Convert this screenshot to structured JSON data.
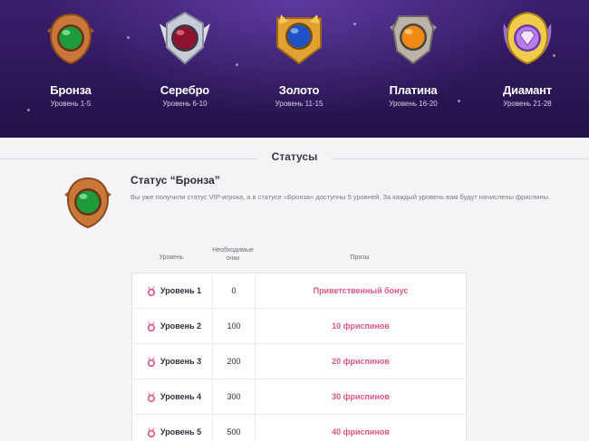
{
  "ranks": [
    {
      "name": "Бронза",
      "levels": "Уровень 1-5",
      "gem": "#1f9a3a",
      "frame": "#c9783a",
      "icon": "bronze-rank-badge-icon"
    },
    {
      "name": "Серебро",
      "levels": "Уровень 6-10",
      "gem": "#8c1230",
      "frame": "#c8ccd6",
      "icon": "silver-rank-badge-icon"
    },
    {
      "name": "Золото",
      "levels": "Уровень 11-15",
      "gem": "#1f52c4",
      "frame": "#e0a233",
      "icon": "gold-rank-badge-icon"
    },
    {
      "name": "Платина",
      "levels": "Уровень 16-20",
      "gem": "#f08a12",
      "frame": "#b9b3a8",
      "icon": "platinum-rank-badge-icon"
    },
    {
      "name": "Диамант",
      "levels": "Уровень 21-28",
      "gem": "#b77ee6",
      "frame": "#f0cc4a",
      "icon": "diamond-rank-badge-icon"
    }
  ],
  "section": {
    "title": "Статусы"
  },
  "status": {
    "heading": "Статус “Бронза”",
    "description": "Вы уже получили статус VIP-игрока, а в статусе «Бронза» доступны 5 уровней. За каждый уровень вам будут начислены фриспины.",
    "badge_icon": "bronze-status-badge-icon"
  },
  "table": {
    "headers": {
      "level": "Уровень",
      "points_line1": "Необходимые",
      "points_line2": "очки",
      "prizes": "Призы"
    },
    "rows": [
      {
        "level": "Уровень 1",
        "points": "0",
        "prize": "Приветственный бонус"
      },
      {
        "level": "Уровень 2",
        "points": "100",
        "prize": "10 фриспинов"
      },
      {
        "level": "Уровень 3",
        "points": "200",
        "prize": "20 фриспинов"
      },
      {
        "level": "Уровень 4",
        "points": "300",
        "prize": "30 фриспинов"
      },
      {
        "level": "Уровень 5",
        "points": "500",
        "prize": "40 фриспинов"
      }
    ],
    "level_icon": "medal-icon"
  },
  "colors": {
    "accent": "#e0577e",
    "hero_bg": "#2c1758"
  }
}
